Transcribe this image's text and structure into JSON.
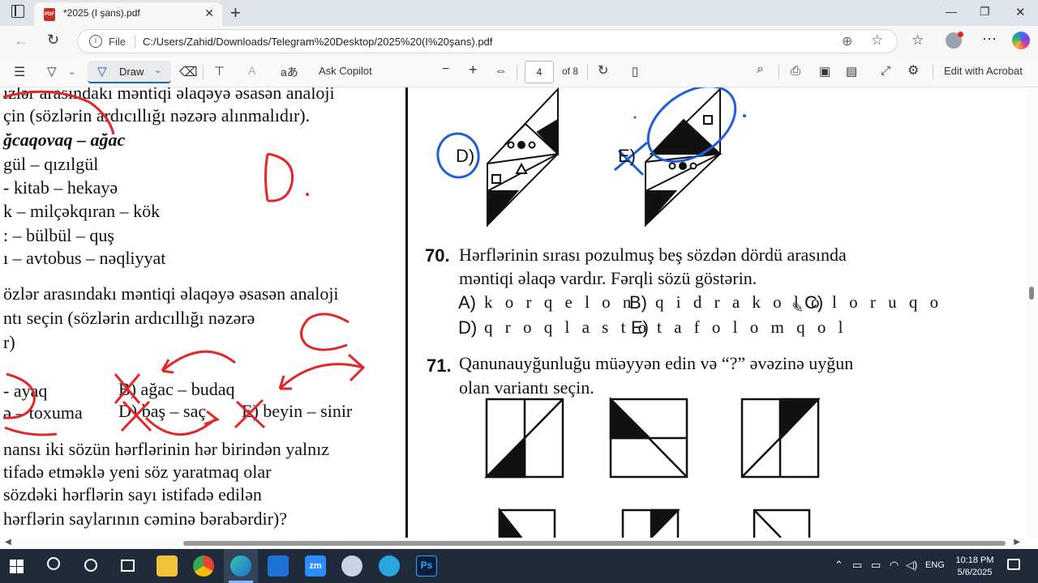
{
  "browser": {
    "tab_title": "*2025 (I şans).pdf",
    "file_label": "File",
    "url": "C:/Users/Zahid/Downloads/Telegram%20Desktop/2025%20(I%20şans).pdf",
    "new_tab_glyph": "+",
    "close_glyph": "✕",
    "window_buttons": [
      "—",
      "❐",
      "✕"
    ]
  },
  "pdf_toolbar": {
    "draw_label": "Draw",
    "ask_copilot_label": "Ask Copilot",
    "zoom_out": "−",
    "zoom_in": "+",
    "page_current": "4",
    "page_total": "of 8",
    "edit_acrobat_label": "Edit with Acrobat",
    "text_size_glyph": "A",
    "aa_glyph": "aあ"
  },
  "left_page": {
    "lines": [
      "ızlər arasındakı məntiqi əlaqəyə əsasən analoji",
      "çin (sözlərin ardıcıllığı nəzərə alınmalıdır).",
      "ğcaqovaq – ağac",
      " gül – qızılgül",
      "- kitab – hekayə",
      "k – milçəkqıran – kök",
      ": – bülbül – quş",
      "ı – avtobus – nəqliyyat",
      "özlər arasındakı məntiqi əlaqəyə əsasən analoji",
      "ntı seçin (sözlərin ardıcıllığı nəzərə",
      "r)",
      "- ayaq",
      "ə – toxuma",
      "B) ağac – budaq",
      "D) baş – saç",
      "E) beyin – sinir",
      "nansı iki sözün hərflərinin hər birindən yalnız",
      "tifadə etməklə yeni söz yaratmaq olar",
      " sözdəki hərflərin sayı istifadə edilən",
      " hərflərin saylarının cəminə bərabərdir)?"
    ],
    "handwriting": [
      "D",
      "C"
    ]
  },
  "right_page": {
    "fig_labels": {
      "d": "D)",
      "e": "E)"
    },
    "q70": {
      "number": "70.",
      "line1": "Hərflərinin sırası pozulmuş beş sözdən dördü arasında",
      "line2": "məntiqi əlaqə vardır. Fərqli sözü göstərin.",
      "options": [
        {
          "label": "A)",
          "text": "k o r q e l o n"
        },
        {
          "label": "B)",
          "text": "q i d r a k o l o"
        },
        {
          "label": "C)",
          "text": "l o r u q o"
        },
        {
          "label": "D)",
          "text": "q r o q l a s t o"
        },
        {
          "label": "E)",
          "text": "t a f o l o m q o l"
        }
      ]
    },
    "q71": {
      "number": "71.",
      "line1": "Qanunauyğunluğu müəyyən edin və “?” əvəzinə uyğun",
      "line2": "olan variantı seçin."
    }
  },
  "taskbar": {
    "language": "ENG",
    "time": "10:18 PM",
    "date": "5/6/2025",
    "zoom_label": "zm",
    "ps_label": "Ps"
  },
  "colors": {
    "ink_red": "#e0282a",
    "ink_blue": "#1f5fd6",
    "taskbar": "#1f2a3a",
    "accent": "#0f6cbd"
  },
  "icons": [
    "sidebar-toggle-icon",
    "pdf-file-icon",
    "back-icon",
    "refresh-icon",
    "info-icon",
    "zoom-icon",
    "favorite-icon",
    "favorites-list-icon",
    "profile-icon",
    "more-icon",
    "copilot-icon",
    "contents-icon",
    "highlight-icon",
    "pen-icon",
    "eraser-icon",
    "text-icon",
    "fit-page-icon",
    "rotate-icon",
    "page-view-icon",
    "search-icon",
    "print-icon",
    "save-icon",
    "save-as-icon",
    "fullscreen-icon",
    "settings-icon",
    "windows-start-icon",
    "search-taskbar-icon",
    "cortana-icon",
    "task-view-icon",
    "file-explorer-icon",
    "chrome-icon",
    "edge-icon",
    "store-icon",
    "zoom-app-icon",
    "paint-icon",
    "telegram-icon",
    "photoshop-icon"
  ]
}
